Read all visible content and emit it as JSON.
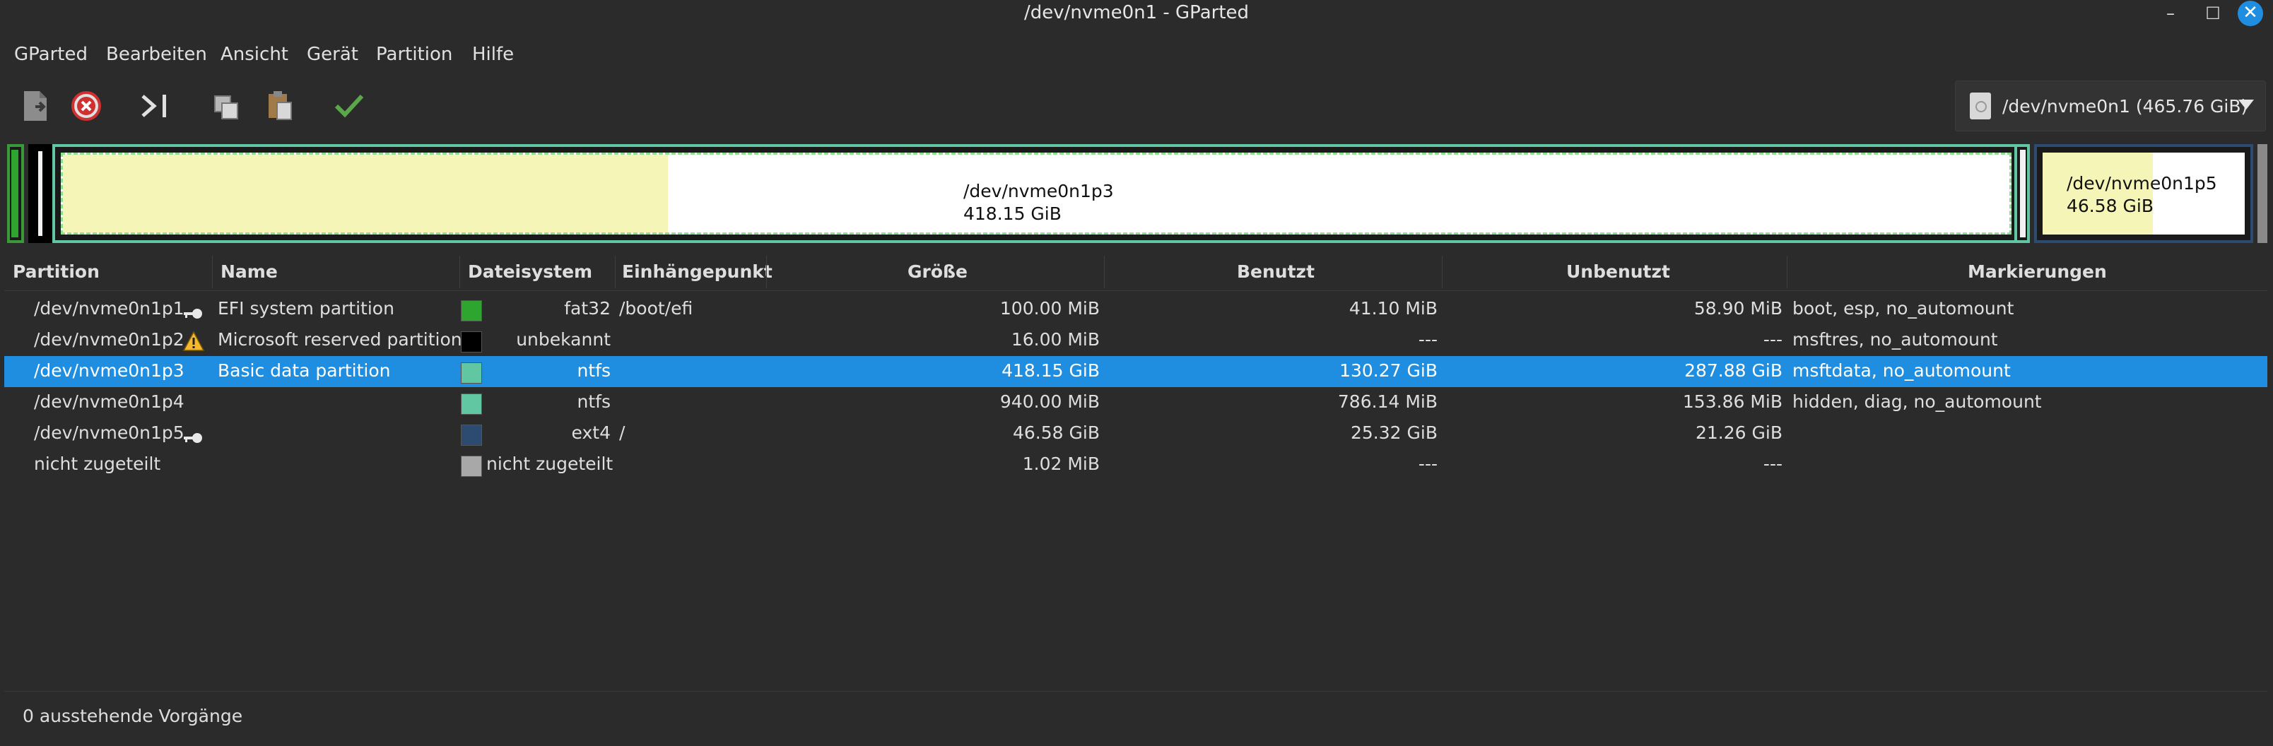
{
  "window": {
    "title": "/dev/nvme0n1 - GParted",
    "minimize_glyph": "–",
    "maximize_glyph": "☐",
    "close_glyph": "✕"
  },
  "menu": [
    "GParted",
    "Bearbeiten",
    "Ansicht",
    "Gerät",
    "Partition",
    "Hilfe"
  ],
  "toolbar": {
    "icons": [
      "new-partition-icon",
      "delete-icon",
      "resize-move-icon",
      "copy-icon",
      "paste-icon",
      "apply-icon"
    ]
  },
  "device_selector": {
    "label": "/dev/nvme0n1 (465.76 GiB)",
    "icon": "disk-icon"
  },
  "disk_map": {
    "p3": {
      "name": "/dev/nvme0n1p3",
      "size": "418.15 GiB",
      "used_fraction": 0.311
    },
    "p5": {
      "name": "/dev/nvme0n1p5",
      "size": "46.58 GiB",
      "used_fraction": 0.544
    }
  },
  "table": {
    "headers": {
      "partition": "Partition",
      "name": "Name",
      "filesystem": "Dateisystem",
      "mountpoint": "Einhängepunkt",
      "size": "Größe",
      "used": "Benutzt",
      "unused": "Unbenutzt",
      "flags": "Markierungen"
    },
    "rows": [
      {
        "partition": "/dev/nvme0n1p1",
        "status_icon": "key-icon",
        "name": "EFI system partition",
        "fs_color": "#2ea52e",
        "filesystem": "fat32",
        "mountpoint": "/boot/efi",
        "size": "100.00 MiB",
        "used": "41.10 MiB",
        "unused": "58.90 MiB",
        "flags": "boot, esp, no_automount"
      },
      {
        "partition": "/dev/nvme0n1p2",
        "status_icon": "warning-icon",
        "name": "Microsoft reserved partition",
        "fs_color": "#000000",
        "filesystem": "unbekannt",
        "mountpoint": "",
        "size": "16.00 MiB",
        "used": "---",
        "unused": "---",
        "flags": "msftres, no_automount"
      },
      {
        "partition": "/dev/nvme0n1p3",
        "status_icon": "",
        "name": "Basic data partition",
        "fs_color": "#61c7a3",
        "filesystem": "ntfs",
        "mountpoint": "",
        "size": "418.15 GiB",
        "used": "130.27 GiB",
        "unused": "287.88 GiB",
        "flags": "msftdata, no_automount",
        "selected": true
      },
      {
        "partition": "/dev/nvme0n1p4",
        "status_icon": "",
        "name": "",
        "fs_color": "#61c7a3",
        "filesystem": "ntfs",
        "mountpoint": "",
        "size": "940.00 MiB",
        "used": "786.14 MiB",
        "unused": "153.86 MiB",
        "flags": "hidden, diag, no_automount"
      },
      {
        "partition": "/dev/nvme0n1p5",
        "status_icon": "key-icon",
        "name": "",
        "fs_color": "#2d4a70",
        "filesystem": "ext4",
        "mountpoint": "/",
        "size": "46.58 GiB",
        "used": "25.32 GiB",
        "unused": "21.26 GiB",
        "flags": ""
      },
      {
        "partition": "nicht zugeteilt",
        "status_icon": "",
        "name": "",
        "fs_color": "#a8a8a8",
        "filesystem": "nicht zugeteilt",
        "mountpoint": "",
        "size": "1.02 MiB",
        "used": "---",
        "unused": "---",
        "flags": ""
      }
    ]
  },
  "status": {
    "pending": "0 ausstehende Vorgänge"
  }
}
